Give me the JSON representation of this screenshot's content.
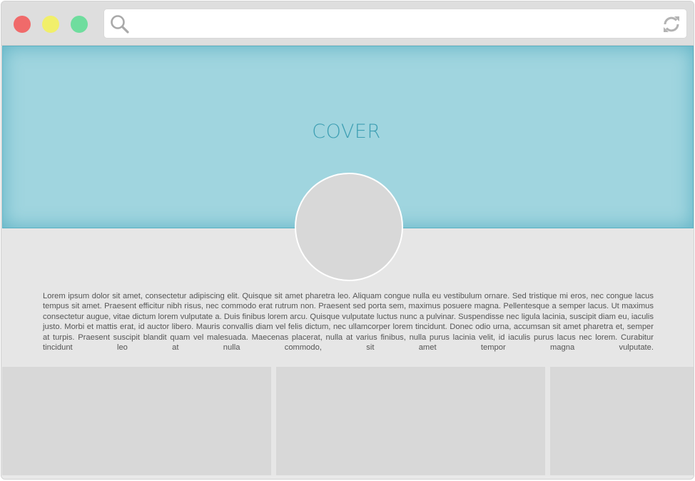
{
  "browser": {
    "window_controls": [
      {
        "name": "close",
        "color": "#f06a6a"
      },
      {
        "name": "minimize",
        "color": "#f1ef6a"
      },
      {
        "name": "maximize",
        "color": "#6fdd9e"
      }
    ],
    "address": {
      "value": "",
      "icons": [
        "search-icon",
        "refresh-icon"
      ]
    }
  },
  "cover": {
    "label": "COVER",
    "background": "#a0d5df",
    "label_color": "#3e9fb3"
  },
  "profile": {
    "avatar_color": "#d8d8d8",
    "bio": "Lorem ipsum dolor sit amet, consectetur adipiscing elit. Quisque sit amet pharetra leo. Aliquam congue nulla eu vestibulum ornare. Sed tristique mi eros, nec congue lacus tempus sit amet. Praesent efficitur nibh risus, nec commodo erat rutrum non. Praesent sed porta sem, maximus posuere magna. Pellentesque a semper lacus. Ut maximus consectetur augue, vitae dictum lorem vulputate a. Duis finibus lorem arcu. Quisque vulputate luctus nunc a pulvinar. Suspendisse nec ligula lacinia, suscipit diam eu, iaculis justo. Morbi et mattis erat, id auctor libero. Mauris convallis diam vel felis dictum, nec ullamcorper lorem tincidunt. Donec odio urna, accumsan sit amet pharetra et, semper at turpis. Praesent suscipit blandit quam vel malesuada. Maecenas placerat, nulla at varius finibus, nulla purus lacinia velit, id iaculis purus lacus nec lorem. Curabitur tincidunt leo at nulla commodo, sit amet tempor magna vulputate."
  },
  "tiles": {
    "count": 3,
    "color": "#d8d8d8"
  }
}
